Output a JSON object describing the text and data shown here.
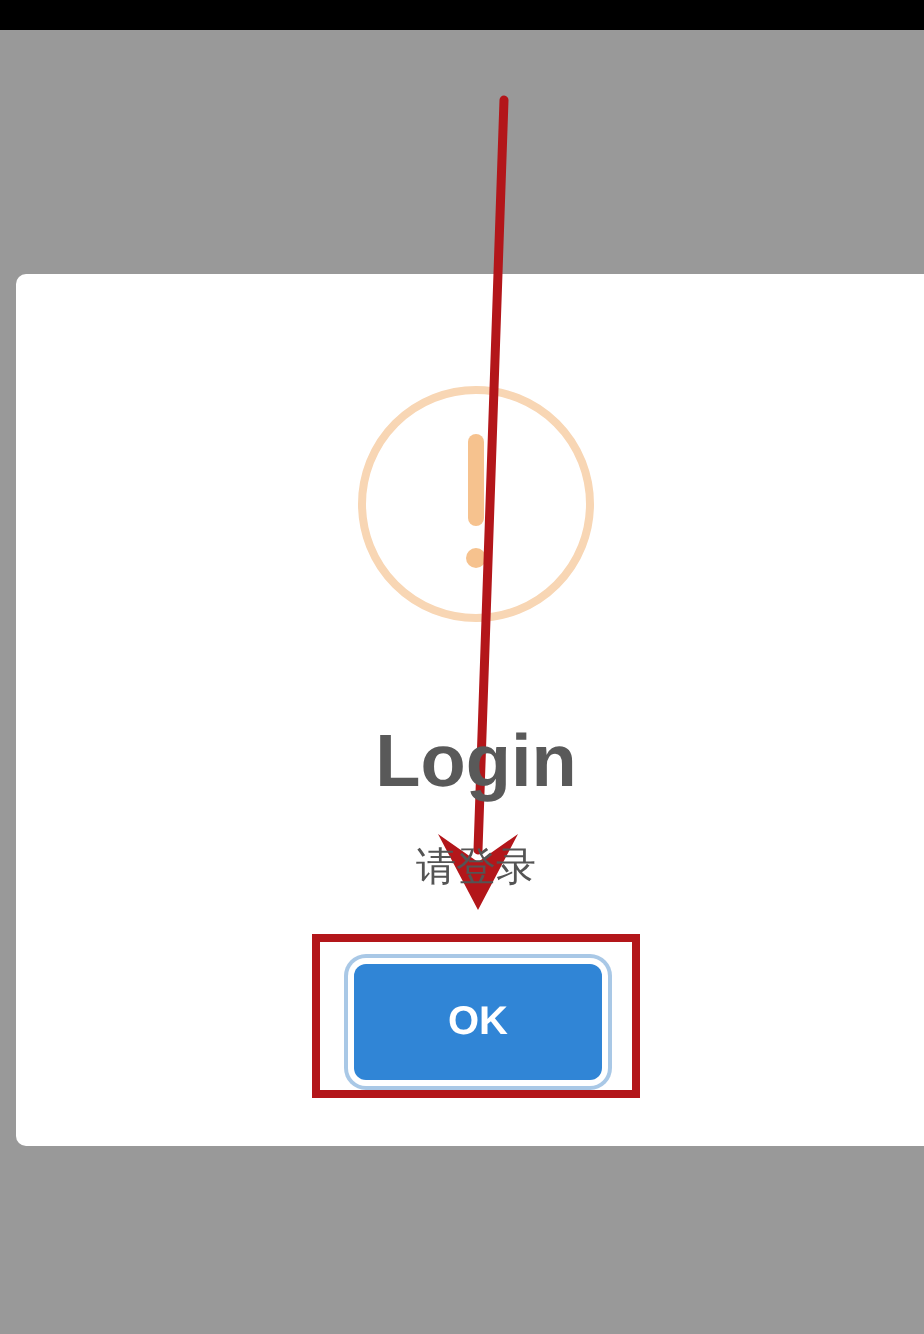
{
  "dialog": {
    "icon": {
      "kind": "warning"
    },
    "title": "Login",
    "message": "请登录",
    "buttons": [
      {
        "label": "OK",
        "highlighted": true
      }
    ]
  }
}
